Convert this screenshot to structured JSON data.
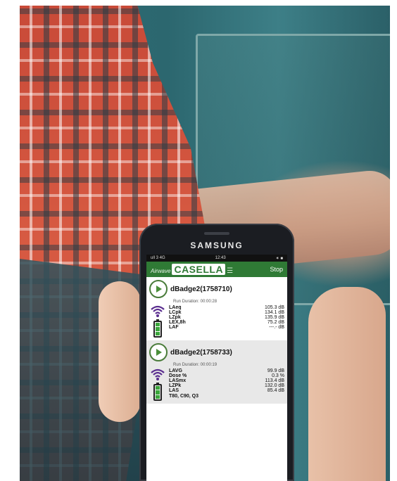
{
  "phone": {
    "brand": "SAMSUNG"
  },
  "status_bar": {
    "left": "ull 3 4G",
    "time": "12:43",
    "right": "✶ ■"
  },
  "app": {
    "logo_prefix": "Airwave",
    "logo_name": "CASELLA",
    "stop_label": "Stop",
    "accent": "#2f7a35"
  },
  "devices": [
    {
      "name": "dBadge2(1758710)",
      "run_duration": "Run Duration:  00:00:28",
      "metrics": [
        {
          "name": "LAeq",
          "value": "105.3 dB"
        },
        {
          "name": "LCpk",
          "value": "134.1 dB"
        },
        {
          "name": "LZpk",
          "value": "135.9 dB"
        },
        {
          "name": "LEX,8h",
          "value": "75.2 dB"
        },
        {
          "name": "LAF",
          "value": "---.- dB"
        }
      ],
      "extra": ""
    },
    {
      "name": "dBadge2(1758733)",
      "run_duration": "Run Duration:  00:00:19",
      "metrics": [
        {
          "name": "LAVG",
          "value": "99.9 dB"
        },
        {
          "name": "Dose %",
          "value": "0.3 %"
        },
        {
          "name": "LASmx",
          "value": "113.4 dB"
        },
        {
          "name": "LZPk",
          "value": "132.0 dB"
        },
        {
          "name": "LAS",
          "value": "85.4 dB"
        }
      ],
      "extra": "T80, C90, Q3"
    }
  ],
  "battery_level": 1.0
}
